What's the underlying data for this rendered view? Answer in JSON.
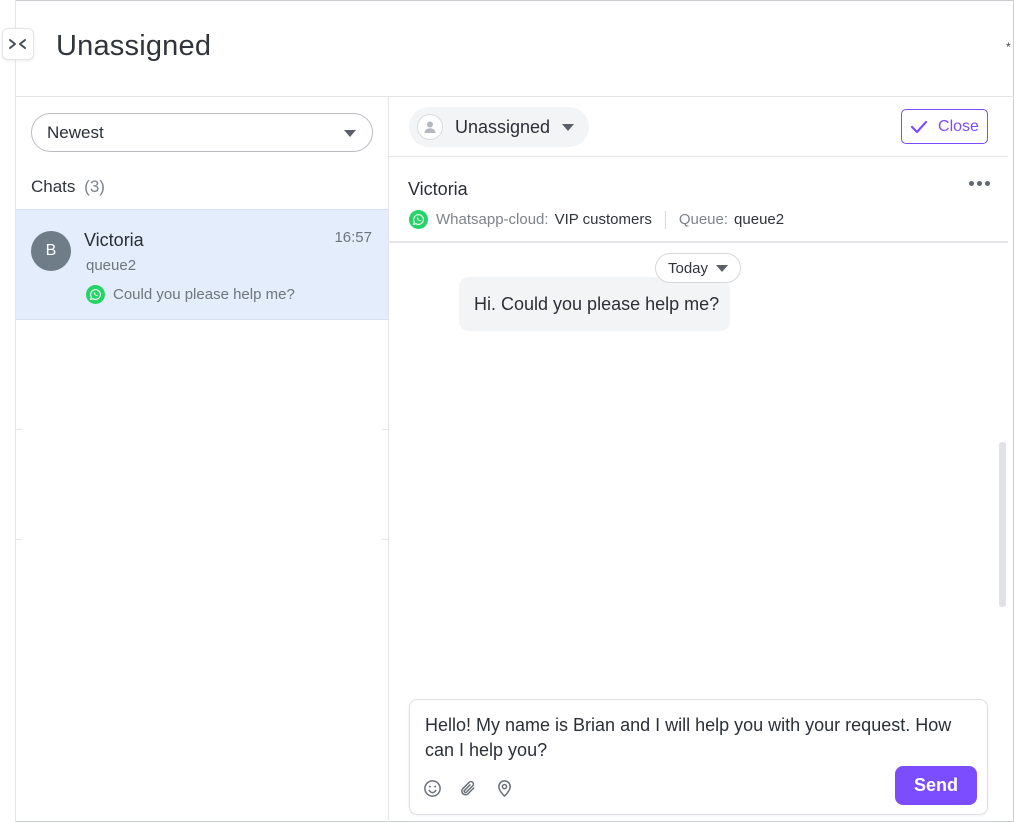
{
  "header": {
    "title": "Unassigned",
    "corner_glyph": "*"
  },
  "list": {
    "sort": {
      "selected": "Newest"
    },
    "chats_label": "Chats",
    "chats_count": "(3)",
    "items": [
      {
        "initial": "B",
        "name": "Victoria",
        "time": "16:57",
        "queue": "queue2",
        "preview": "Could you please help me?",
        "channel_icon": "whatsapp-icon"
      }
    ]
  },
  "chat": {
    "assignee": "Unassigned",
    "close_label": "Close",
    "contact_name": "Victoria",
    "channel_label": "Whatsapp-cloud:",
    "channel_value": "VIP customers",
    "queue_label": "Queue:",
    "queue_value": "queue2",
    "date_chip": "Today",
    "messages": [
      {
        "text": "Hi. Could you please help me?"
      }
    ],
    "composer": {
      "text": "Hello! My name is Brian and I will help you with your request. How can I help you?",
      "send_label": "Send"
    }
  },
  "colors": {
    "accent": "#7c4dff",
    "selected_row": "#e3edfb",
    "whatsapp": "#25d366",
    "avatar": "#6f7d89"
  }
}
